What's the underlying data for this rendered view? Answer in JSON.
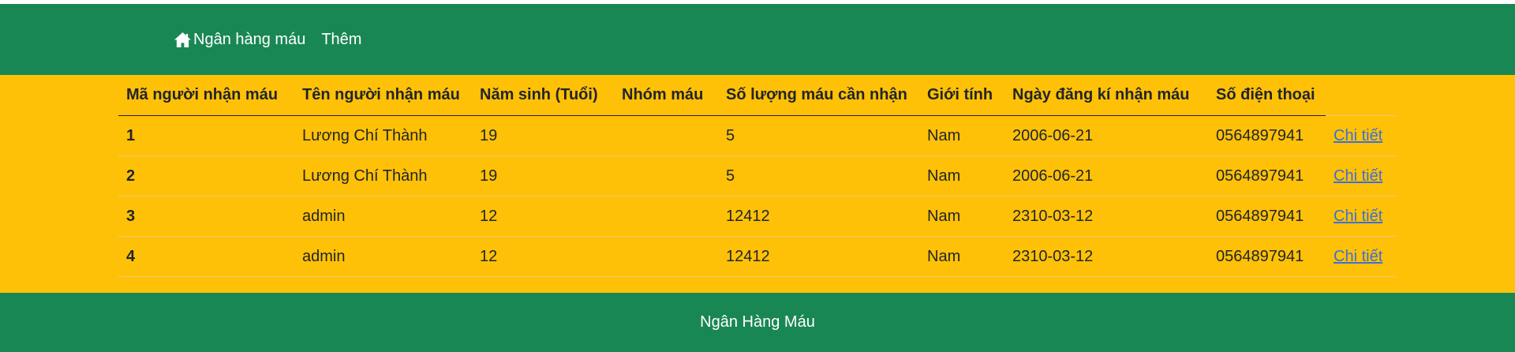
{
  "nav": {
    "brand_label": "Ngân hàng máu",
    "more_label": "Thêm"
  },
  "table": {
    "headers": [
      "Mã người nhận máu",
      "Tên người nhận máu",
      "Năm sinh (Tuổi)",
      "Nhóm máu",
      "Số lượng máu cần nhận",
      "Giới tính",
      "Ngày đăng kí nhận máu",
      "Số điện thoại"
    ],
    "rows": [
      {
        "id": "1",
        "name": "Lương Chí Thành",
        "age": "19",
        "blood_type": "",
        "amount": "5",
        "gender": "Nam",
        "date": "2006-06-21",
        "phone": "0564897941",
        "action": "Chi tiết"
      },
      {
        "id": "2",
        "name": "Lương Chí Thành",
        "age": "19",
        "blood_type": "",
        "amount": "5",
        "gender": "Nam",
        "date": "2006-06-21",
        "phone": "0564897941",
        "action": "Chi tiết"
      },
      {
        "id": "3",
        "name": "admin",
        "age": "12",
        "blood_type": "",
        "amount": "12412",
        "gender": "Nam",
        "date": "2310-03-12",
        "phone": "0564897941",
        "action": "Chi tiết"
      },
      {
        "id": "4",
        "name": "admin",
        "age": "12",
        "blood_type": "",
        "amount": "12412",
        "gender": "Nam",
        "date": "2310-03-12",
        "phone": "0564897941",
        "action": "Chi tiết"
      }
    ]
  },
  "footer": {
    "text": "Ngân Hàng Máu"
  },
  "colors": {
    "nav_green": "#198754",
    "content_yellow": "#ffc107",
    "link_blue": "#3d6fd6"
  }
}
